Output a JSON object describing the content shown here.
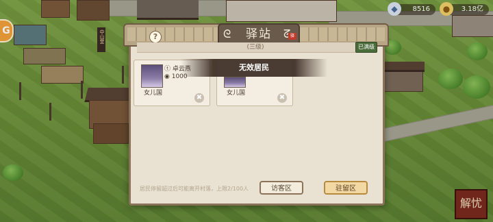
{
  "hud": {
    "left_button_glyph": "G",
    "resource1": {
      "icon": "gem-icon",
      "value": "8516"
    },
    "resource2": {
      "icon": "coin-icon",
      "value": "3.18亿"
    },
    "corner_seal_text": "解忧"
  },
  "world": {
    "flag_text": "中山堂"
  },
  "modal": {
    "title": "驿站",
    "title_seal": "驿",
    "level_text": "(三级)",
    "upgrade_label": "已满级",
    "help_glyph": "?",
    "cards": [
      {
        "name": "卓云燕",
        "cost": "1000",
        "origin": "女儿国",
        "close_glyph": "✖"
      },
      {
        "name": "",
        "cost": "",
        "origin": "女儿国",
        "close_glyph": "✖"
      }
    ],
    "toast": "无效居民",
    "footer_note": "居民停留超过后可能离开村落，上限2/100人",
    "visit_button": "访客区",
    "stay_button": "驻留区"
  },
  "colors": {
    "panel": "#e9e1d1",
    "title_plate": "#6a5a4c",
    "accent_gold": "#f2d9a3",
    "grass": "#6e8f3a"
  }
}
